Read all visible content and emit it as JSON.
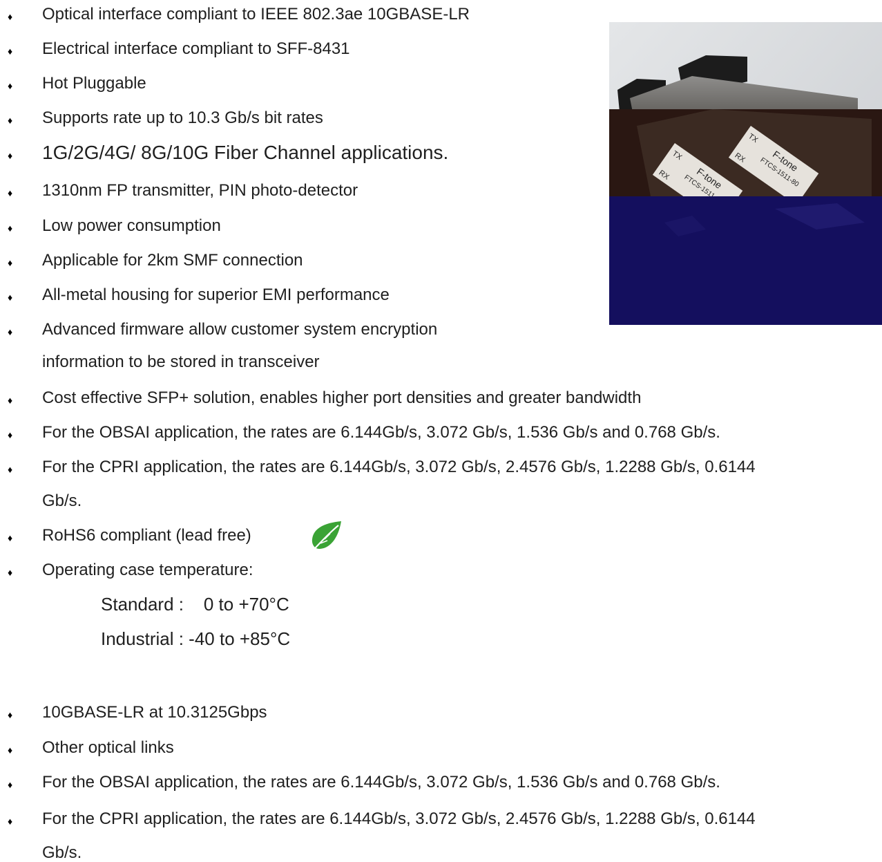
{
  "features": [
    "Optical interface compliant to IEEE 802.3ae 10GBASE-LR",
    "Electrical interface compliant to SFF-8431",
    "Hot Pluggable",
    "Supports rate up to 10.3 Gb/s bit rates",
    "1G/2G/4G/ 8G/10G Fiber Channel applications.",
    "1310nm FP transmitter, PIN photo-detector",
    "Low power consumption",
    "Applicable for 2km SMF connection",
    "All-metal housing for superior EMI performance",
    "Advanced firmware allow customer system encryption",
    "Cost effective SFP+ solution, enables higher port densities and greater bandwidth",
    "For the OBSAI application, the rates are 6.144Gb/s, 3.072 Gb/s, 1.536 Gb/s and 0.768 Gb/s.",
    "For the CPRI application, the rates are 6.144Gb/s, 3.072 Gb/s, 2.4576 Gb/s, 1.2288 Gb/s, 0.6144",
    "RoHS6 compliant (lead free)",
    "Operating case temperature:"
  ],
  "feature_continuations": {
    "encryption": "information to be stored in transceiver",
    "cpri": "Gb/s."
  },
  "temperature": {
    "standard": "Standard :    0 to +70°C",
    "industrial": "Industrial : -40 to +85°C"
  },
  "applications": [
    "10GBASE-LR at 10.3125Gbps",
    "Other optical links",
    "For the OBSAI application, the rates are 6.144Gb/s, 3.072 Gb/s, 1.536 Gb/s and 0.768 Gb/s.",
    "For the CPRI application, the rates are 6.144Gb/s, 3.072 Gb/s, 2.4576 Gb/s, 1.2288 Gb/s, 0.6144"
  ],
  "applications_continuation": "Gb/s.",
  "bullet_symbol": "♦",
  "product_labels": {
    "brand": "F-tone",
    "model": "FTCS-1511-80",
    "tx": "TX",
    "rx": "RX"
  },
  "icons": {
    "leaf": "leaf-icon"
  },
  "colors": {
    "leaf": "#3aa335",
    "photo_band": "#140f5e"
  }
}
